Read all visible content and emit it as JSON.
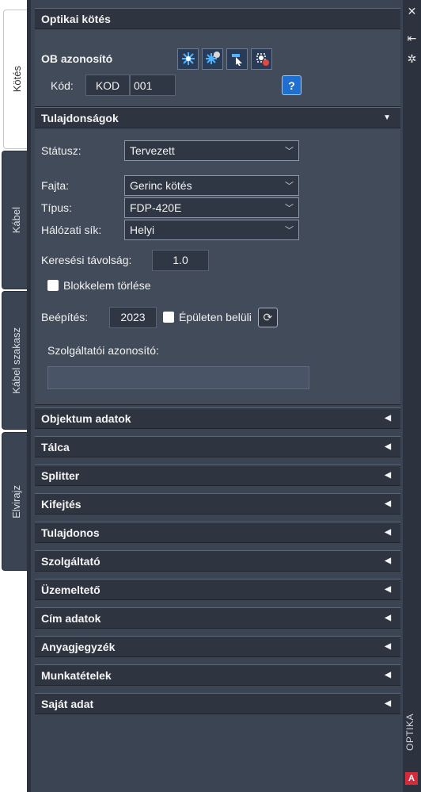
{
  "tabs": [
    {
      "label": "Kötés",
      "active": true
    },
    {
      "label": "Kábel",
      "active": false
    },
    {
      "label": "Kábel szakasz",
      "active": false
    },
    {
      "label": "Elvirajz",
      "active": false
    }
  ],
  "header": {
    "title": "Optikai kötés"
  },
  "ob": {
    "label": "OB azonosító",
    "icons": [
      "spark-icon",
      "spark-link-icon",
      "cursor-select-icon",
      "delete-marker-icon"
    ],
    "kod_label": "Kód:",
    "kod_prefix": "KOD",
    "kod_number": "001",
    "help_icon": "?"
  },
  "properties": {
    "title": "Tulajdonságok",
    "status_label": "Státusz:",
    "status_value": "Tervezett",
    "fajta_label": "Fajta:",
    "fajta_value": "Gerinc kötés",
    "tipus_label": "Típus:",
    "tipus_value": "FDP-420E",
    "sik_label": "Hálózati sík:",
    "sik_value": "Helyi",
    "kereses_label": "Keresési távolság:",
    "kereses_value": "1.0",
    "blokk_label": "Blokkelem törlése",
    "beepites_label": "Beépítés:",
    "beepites_value": "2023",
    "epuleten_label": "Épületen belüli",
    "szolg_label": "Szolgáltatói azonosító:",
    "szolg_value": ""
  },
  "sections": [
    "Objektum adatok",
    "Tálca",
    "Splitter",
    "Kifejtés",
    "Tulajdonos",
    "Szolgáltató",
    "Üzemeltető",
    "Cím adatok",
    "Anyagjegyzék",
    "Munkatételek",
    "Saját adat"
  ],
  "side": {
    "close": "✕",
    "pin": "⇤",
    "settings": "✲",
    "vertical_label": "OPTIKA",
    "logo": "A"
  },
  "colors": {
    "panel": "#3b4453",
    "section_header": "#2e3440",
    "accent_blue": "#1e6fd0",
    "logo_red": "#d42b3a"
  }
}
